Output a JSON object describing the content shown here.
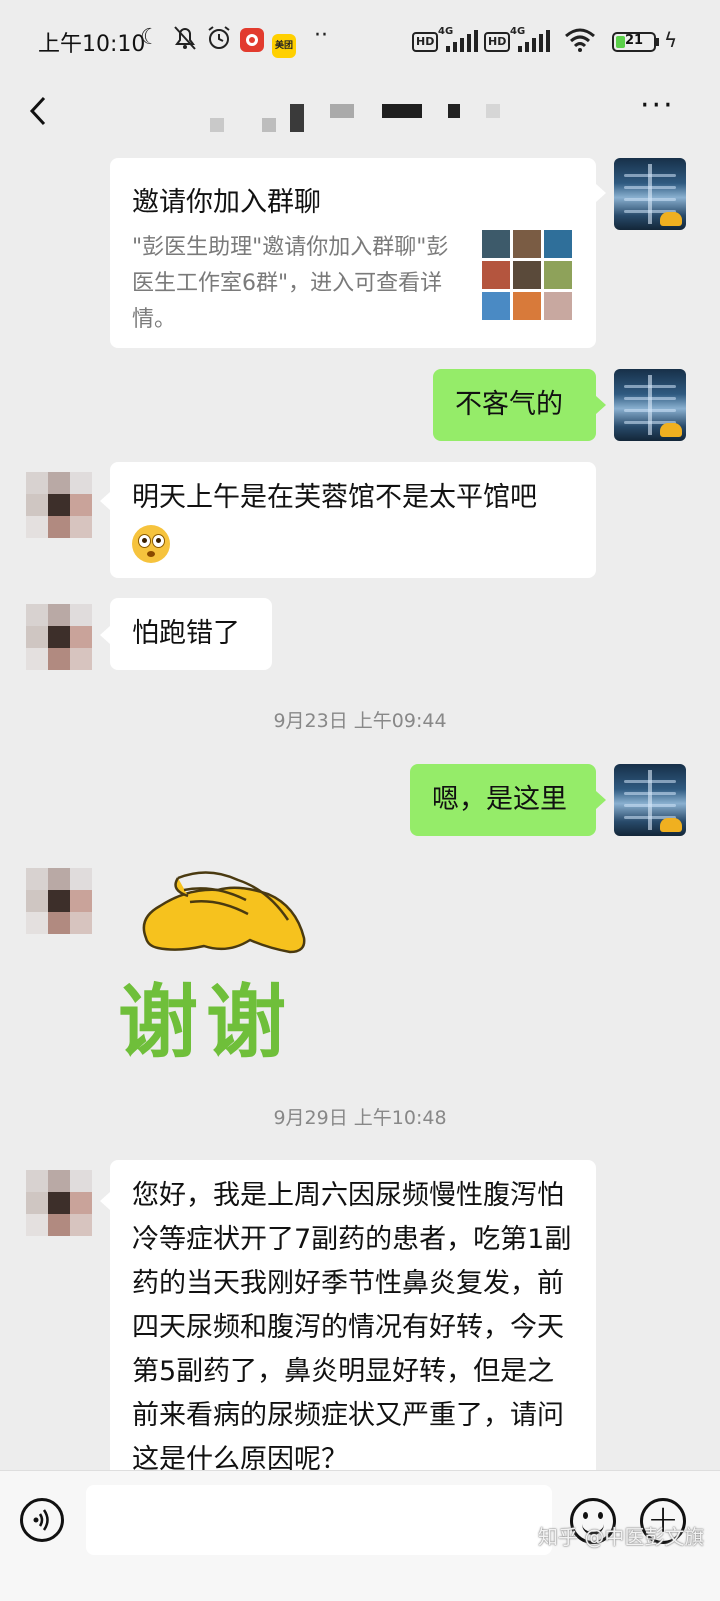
{
  "status_bar": {
    "time": "上午10:10",
    "net_label_1": "HD",
    "net_gen_1": "4G",
    "net_label_2": "HD",
    "net_gen_2": "4G",
    "app_badge_text": "美团",
    "more_dots": "··",
    "battery_level": "21",
    "icons": [
      "moon-icon",
      "mute-bell-icon",
      "alarm-icon",
      "app-notification-icon",
      "meituan-icon",
      "signal-icon",
      "wifi-icon",
      "battery-icon",
      "charging-icon"
    ]
  },
  "header": {
    "title": "",
    "back_icon": "chevron-left-icon",
    "more_label": "···"
  },
  "messages": {
    "invite_card": {
      "title": "邀请你加入群聊",
      "description": "\"彭医生助理\"邀请你加入群聊\"彭医生工作室6群\"，进入可查看详情。"
    },
    "sent_1": "不客气的",
    "received_1": "明天上午是在芙蓉馆不是太平馆吧",
    "received_2": "怕跑错了",
    "time_1": "9月23日 上午09:44",
    "sent_2": "嗯，是这里",
    "sticker_text": "谢谢",
    "time_2": "9月29日 上午10:48",
    "received_3": "您好，我是上周六因尿频慢性腹泻怕冷等症状开了7副药的患者，吃第1副药的当天我刚好季节性鼻炎复发，前四天尿频和腹泻的情况有好转，今天第5副药了，鼻炎明显好转，但是之前来看病的尿频症状又严重了，请问这是什么原因呢？"
  },
  "input_bar": {
    "placeholder": "",
    "voice_icon": "voice-icon",
    "emoji_icon": "emoji-icon",
    "plus_icon": "plus-icon"
  },
  "watermark": "知乎 @中医彭文旗",
  "colors": {
    "background": "#ededed",
    "sent_bubble": "#95ec69",
    "received_bubble": "#ffffff",
    "timestamp": "#888888"
  }
}
